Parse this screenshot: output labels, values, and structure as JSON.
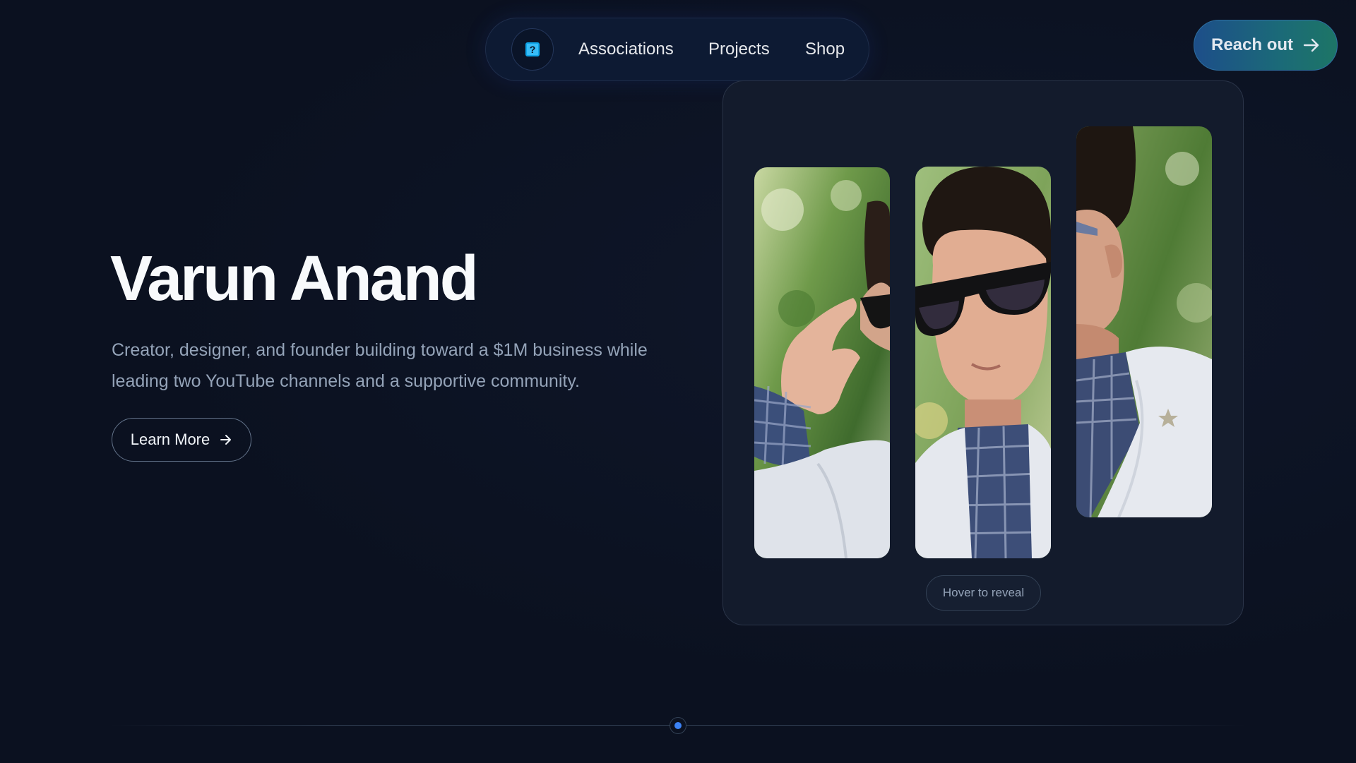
{
  "nav": {
    "logo_icon": "square-logo-icon",
    "logo_glyph": "?",
    "items": [
      {
        "label": "Associations"
      },
      {
        "label": "Projects"
      },
      {
        "label": "Shop"
      }
    ]
  },
  "cta": {
    "label": "Reach out",
    "icon": "arrow-right-icon"
  },
  "hero": {
    "title": "Varun Anand",
    "subtitle": "Creator, designer, and founder building toward a $1M business while leading two YouTube channels and a supportive community.",
    "button_label": "Learn More",
    "button_icon": "arrow-right-icon"
  },
  "gallery": {
    "photos": [
      {
        "name": "photo-adjusting-sunglasses"
      },
      {
        "name": "photo-smiling-sunglasses"
      },
      {
        "name": "photo-side-profile"
      }
    ],
    "hint": "Hover to reveal"
  },
  "colors": {
    "background": "#0b1120",
    "accent_blue": "#1d4e89",
    "accent_teal": "#1d7566",
    "dot": "#3b82f6"
  }
}
